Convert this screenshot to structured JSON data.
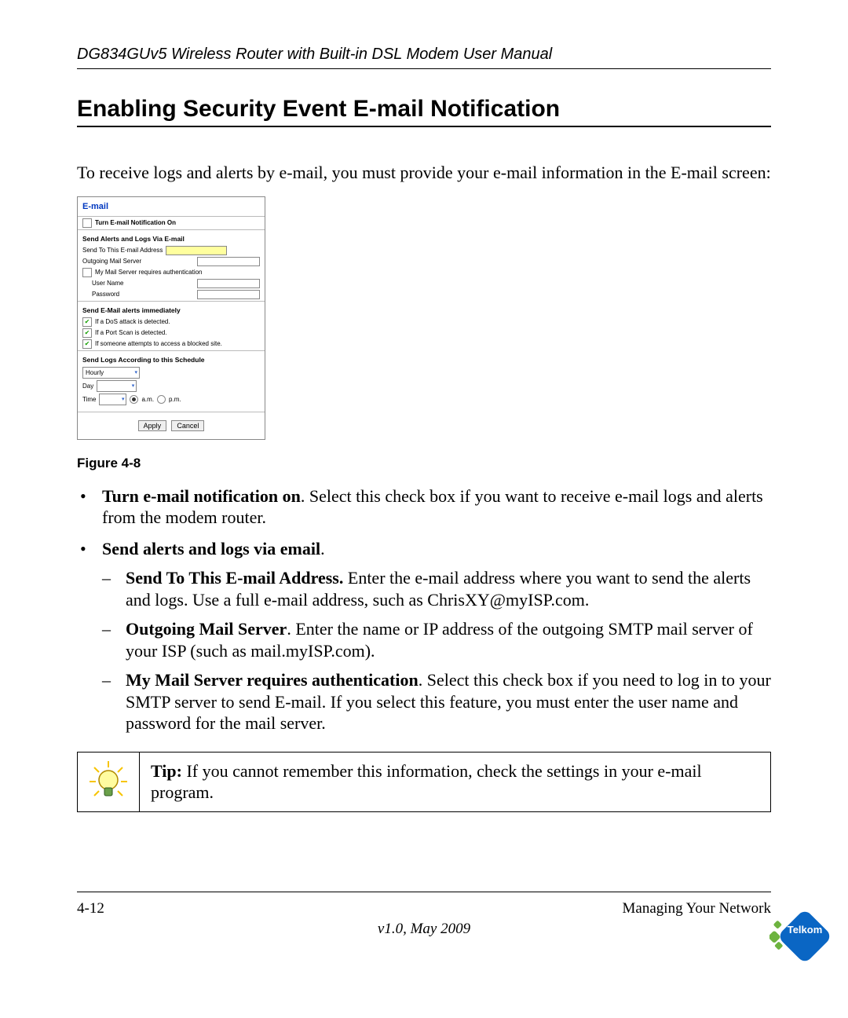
{
  "header": {
    "running_head": "DG834GUv5 Wireless Router with Built-in DSL Modem User Manual"
  },
  "section": {
    "title": "Enabling Security Event E-mail Notification"
  },
  "intro": "To receive logs and alerts by e-mail, you must provide your e-mail information in the E-mail screen:",
  "figure": {
    "caption": "Figure 4-8"
  },
  "shot": {
    "title": "E-mail",
    "turn_on_label": "Turn E-mail Notification On",
    "sec1_title": "Send Alerts and Logs Via E-mail",
    "send_to_label": "Send To This E-mail Address",
    "outgoing_label": "Outgoing Mail Server",
    "auth_label": "My Mail Server requires authentication",
    "user_label": "User Name",
    "pass_label": "Password",
    "sec2_title": "Send E-Mail alerts immediately",
    "opt_dos": "If a DoS attack is detected.",
    "opt_portscan": "If a Port Scan is detected.",
    "opt_blocked": "If someone attempts to access a blocked site.",
    "sec3_title": "Send Logs According to this Schedule",
    "schedule_value": "Hourly",
    "day_label": "Day",
    "time_label": "Time",
    "am_label": "a.m.",
    "pm_label": "p.m.",
    "apply": "Apply",
    "cancel": "Cancel"
  },
  "bullets": [
    {
      "lead": "Turn e-mail notification on",
      "rest": ". Select this check box if you want to receive e-mail logs and alerts from the modem router."
    },
    {
      "lead": "Send alerts and logs via email",
      "rest": ".",
      "dashes": [
        {
          "lead": "Send To This E-mail Address.",
          "rest": " Enter the e-mail address where you want to send the alerts and logs. Use a full e-mail address, such as ChrisXY@myISP.com."
        },
        {
          "lead": "Outgoing Mail Server",
          "rest": ". Enter the name or IP address of the outgoing SMTP mail server of your ISP (such as mail.myISP.com)."
        },
        {
          "lead": "My Mail Server requires authentication",
          "rest": ". Select this check box if you need to log in to your SMTP server to send E-mail. If you select this feature, you must enter the user name and password for the mail server."
        }
      ]
    }
  ],
  "tip": {
    "lead": "Tip:",
    "text": " If you cannot remember this information, check the settings in your e-mail program."
  },
  "footer": {
    "page": "4-12",
    "section": "Managing Your Network",
    "version": "v1.0, May 2009"
  },
  "logo": {
    "text": "Telkom"
  }
}
